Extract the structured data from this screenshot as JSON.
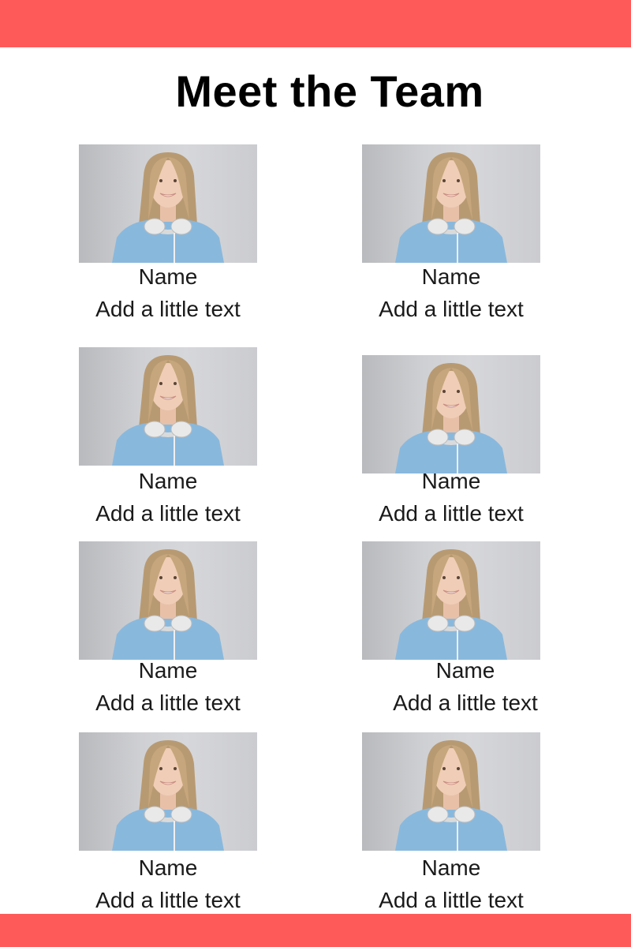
{
  "header": {
    "title": "Meet the Team"
  },
  "colors": {
    "accent": "#FF5A5A",
    "background": "#FFFFFF",
    "text": "#1A1A1A"
  },
  "team": [
    {
      "name": "Name",
      "text": "Add a little text"
    },
    {
      "name": "Name",
      "text": "Add a little text"
    },
    {
      "name": "Name",
      "text": "Add a little text"
    },
    {
      "name": "Name",
      "text": "Add a little text"
    },
    {
      "name": "Name",
      "text": "Add a little text"
    },
    {
      "name": "Name",
      "text": "Add a little text"
    },
    {
      "name": "Name",
      "text": "Add a little text"
    },
    {
      "name": "Name",
      "text": "Add a little text"
    }
  ]
}
